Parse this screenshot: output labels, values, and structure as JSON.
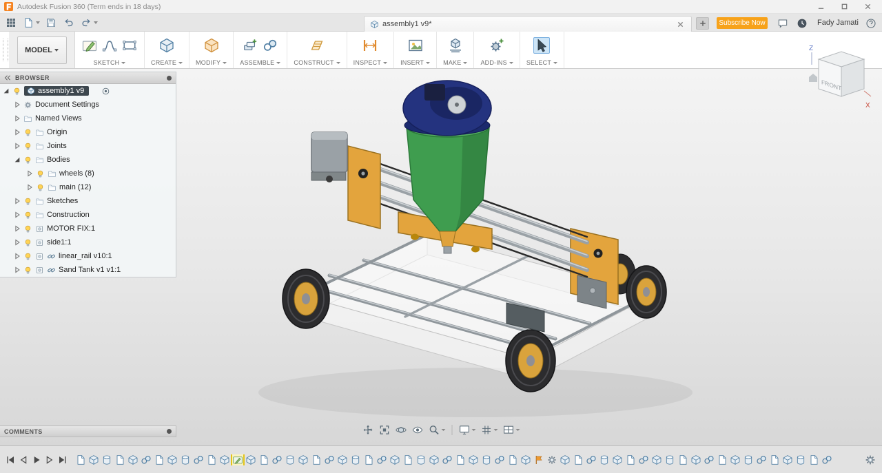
{
  "titlebar": {
    "title": "Autodesk Fusion 360 (Term ends in 18 days)"
  },
  "appbar": {
    "document_tab": {
      "title": "assembly1 v9*"
    },
    "subscribe_button": "Subscribe Now",
    "username": "Fady Jamati"
  },
  "toolbar": {
    "workspace_selector": "MODEL",
    "groups": [
      {
        "label": "SKETCH"
      },
      {
        "label": "CREATE"
      },
      {
        "label": "MODIFY"
      },
      {
        "label": "ASSEMBLE"
      },
      {
        "label": "CONSTRUCT"
      },
      {
        "label": "INSPECT"
      },
      {
        "label": "INSERT"
      },
      {
        "label": "MAKE"
      },
      {
        "label": "ADD-INS"
      },
      {
        "label": "SELECT"
      }
    ]
  },
  "browser": {
    "header": "BROWSER",
    "root_item": "assembly1 v9",
    "items": [
      {
        "label": "Document Settings"
      },
      {
        "label": "Named Views"
      },
      {
        "label": "Origin"
      },
      {
        "label": "Joints"
      },
      {
        "label": "Bodies"
      },
      {
        "label": "wheels (8)"
      },
      {
        "label": "main (12)"
      },
      {
        "label": "Sketches"
      },
      {
        "label": "Construction"
      },
      {
        "label": "MOTOR FIX:1"
      },
      {
        "label": "side1:1"
      },
      {
        "label": "linear_rail v10:1"
      },
      {
        "label": "Sand Tank v1 v1:1"
      }
    ]
  },
  "viewcube": {
    "front_label": "FRONT",
    "z_axis": "Z",
    "x_axis": "X"
  },
  "comments": {
    "header": "COMMENTS"
  },
  "timeline": {
    "highlight_index": 12,
    "icons": [
      "doc",
      "cube",
      "cyl",
      "doc",
      "cube",
      "joint",
      "doc",
      "cube",
      "cyl",
      "joint",
      "doc",
      "cube",
      "sketch",
      "cube",
      "doc",
      "joint",
      "cyl",
      "cube",
      "doc",
      "joint",
      "cube",
      "cyl",
      "doc",
      "joint",
      "cube",
      "doc",
      "cyl",
      "cube",
      "joint",
      "doc",
      "cube",
      "cyl",
      "joint",
      "doc",
      "cube",
      "flag",
      "gear",
      "cube",
      "doc",
      "joint",
      "cyl",
      "cube",
      "doc",
      "joint",
      "cube",
      "cyl",
      "doc",
      "cube",
      "joint",
      "doc",
      "cube",
      "cyl",
      "joint",
      "doc",
      "cube",
      "cyl",
      "doc",
      "joint"
    ]
  },
  "colors": {
    "accent_orange": "#f7a21a",
    "selected_tool_highlight": "#cde5f7",
    "root_row_background": "#3d474e",
    "timeline_icon_blue": "#4f7ea3",
    "model_yellow": "#e3a43d",
    "hopper_green": "#3f9d4f",
    "dome_blue": "#24337f"
  }
}
